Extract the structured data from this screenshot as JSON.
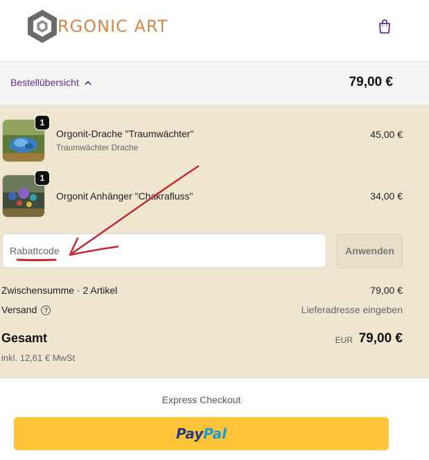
{
  "header": {
    "logo_text": "RGONIC ART",
    "logo_letter": "O",
    "cart_icon": "shopping-bag-icon"
  },
  "summary": {
    "toggle_label": "Bestellübersicht",
    "toggle_icon": "chevron-up-icon",
    "total": "79,00 €"
  },
  "items": [
    {
      "name": "Orgonit-Drache \"Traumwächter\"",
      "variant": "Traumwächter Drache",
      "price": "45,00 €",
      "quantity": "1"
    },
    {
      "name": "Orgonit Anhänger \"Chakrafluss\"",
      "variant": "",
      "price": "34,00 €",
      "quantity": "1"
    }
  ],
  "discount": {
    "placeholder": "Rabattcode",
    "apply_label": "Anwenden"
  },
  "totals": {
    "subtotal_label": "Zwischensumme · 2 Artikel",
    "subtotal_value": "79,00 €",
    "shipping_label": "Versand",
    "shipping_value": "Lieferadresse eingeben",
    "total_label": "Gesamt",
    "currency": "EUR",
    "total_value": "79,00 €",
    "tax_note": "inkl. 12,61 € MwSt"
  },
  "express": {
    "label": "Express Checkout",
    "paypal_part1": "Pay",
    "paypal_part2": "Pal"
  },
  "colors": {
    "accent": "#5b2e8a",
    "logo": "#d4874a",
    "panel_bg": "#efe6d0",
    "paypal": "#ffc439",
    "annotation": "#c0282d"
  }
}
